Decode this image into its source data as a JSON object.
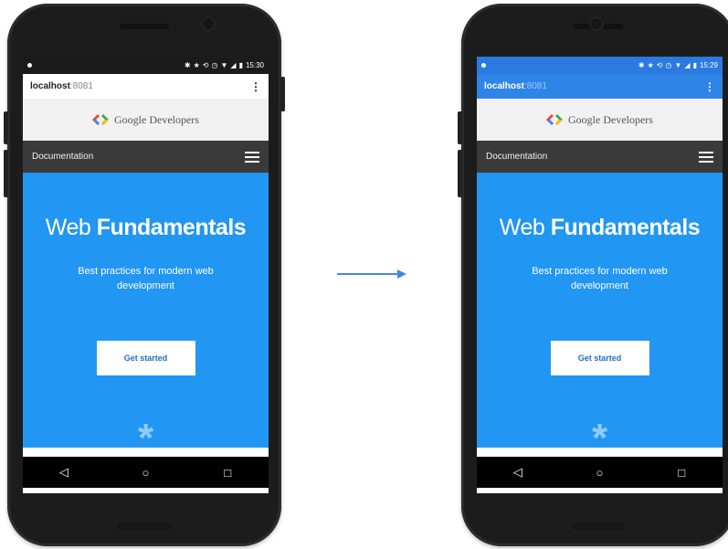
{
  "colors": {
    "hero_blue": "#2196f3",
    "nav_dark": "#3a3a3a",
    "banner_gray": "#f1f1f1",
    "arrow_blue": "#3f86e8"
  },
  "phones": [
    {
      "side": "left",
      "status_bar": {
        "time": "15:30",
        "bg": "#1b1b1b"
      },
      "url_bar": {
        "host": "localhost",
        "port": ":8081",
        "menu_icon": "kebab-icon",
        "bg": "#ffffff",
        "text_color": "#222222"
      }
    },
    {
      "side": "right",
      "status_bar": {
        "time": "15:29",
        "bg": "#2a7ae2"
      },
      "url_bar": {
        "host": "localhost",
        "port": ":8081",
        "menu_icon": "kebab-icon",
        "bg": "#2f84e8",
        "text_color": "#ffffff"
      }
    }
  ],
  "banner": {
    "brand": "Google Developers",
    "logo_icon": "google-developers-logo-icon"
  },
  "nav": {
    "label": "Documentation",
    "menu_icon": "hamburger-icon"
  },
  "hero": {
    "title_light": "Web",
    "title_bold": "Fundamentals",
    "subtitle": "Best practices for modern web development",
    "cta": "Get started",
    "decoration_icon": "asterisk-icon"
  },
  "system_nav": {
    "back": "◁",
    "home": "○",
    "recents": "□"
  },
  "transition_arrow": "arrow-right-icon"
}
